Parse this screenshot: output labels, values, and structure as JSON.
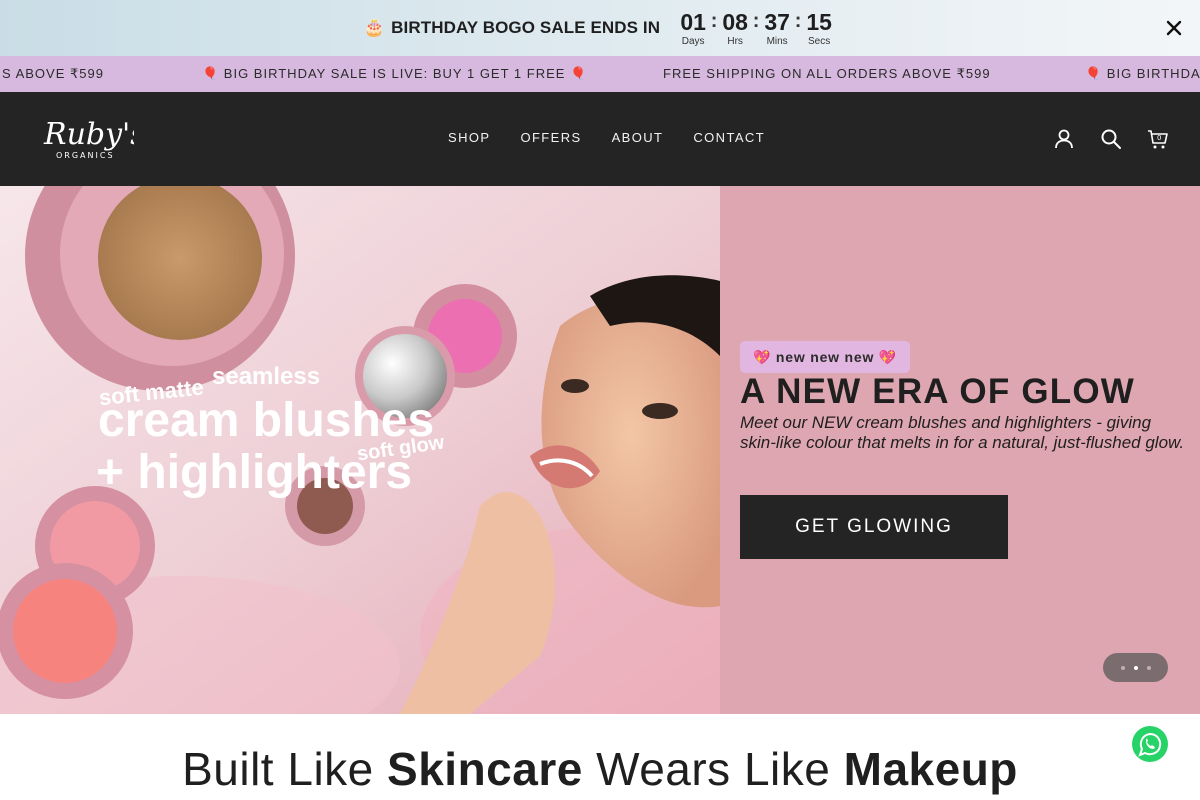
{
  "countdown": {
    "cake_emoji": "🎂",
    "title": "BIRTHDAY BOGO SALE ENDS IN",
    "days": "01",
    "days_label": "Days",
    "hours": "08",
    "hours_label": "Hrs",
    "mins": "37",
    "mins_label": "Mins",
    "secs": "15",
    "secs_label": "Secs",
    "separator": ":"
  },
  "marquee": {
    "items": [
      "S ABOVE ₹599",
      "🎈 BIG BIRTHDAY SALE IS LIVE: BUY 1 GET 1 FREE 🎈",
      "FREE SHIPPING ON ALL ORDERS ABOVE ₹599",
      "🎈 BIG BIRTHDAY"
    ]
  },
  "header": {
    "logo_text": "Ruby's",
    "logo_subtext": "ORGANICS",
    "nav": [
      "SHOP",
      "OFFERS",
      "ABOUT",
      "CONTACT"
    ],
    "icons": [
      "account-icon",
      "search-icon",
      "cart-icon"
    ],
    "cart_count": "0"
  },
  "hero": {
    "image_text": {
      "line1": "seamless",
      "line1_pre": "soft matte",
      "line2": "cream blushes",
      "line2_post": "soft glow",
      "line3": "+ highlighters"
    },
    "badge": "💖 new new new 💖",
    "title": "A NEW ERA OF GLOW",
    "subtitle": "Meet our NEW cream blushes and highlighters - giving skin-like colour that melts in for a natural, just-flushed glow.",
    "cta": "GET GLOWING",
    "slides": 3,
    "active_slide": 2
  },
  "tagline": {
    "part1": "Built Like ",
    "part2": "Skincare",
    "part3": " Wears Like ",
    "part4": "Makeup"
  },
  "colors": {
    "top_bar": "#dbe8ee",
    "marquee": "#d7b9df",
    "header": "#242424",
    "hero_panel": "#dea6b0",
    "badge": "#e1b6e0",
    "cta": "#242424"
  }
}
